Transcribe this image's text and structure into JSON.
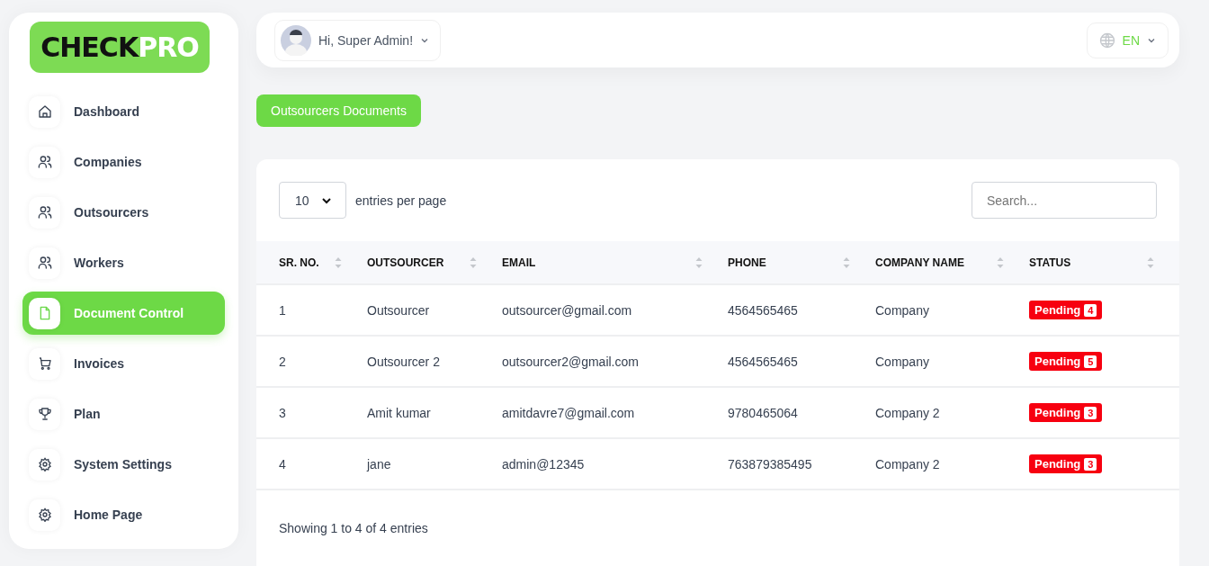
{
  "logo": {
    "dark": "CHECK",
    "light": "PRO"
  },
  "sidebar": {
    "items": [
      {
        "label": "Dashboard",
        "kind": "home",
        "selected": false
      },
      {
        "label": "Companies",
        "kind": "users",
        "selected": false
      },
      {
        "label": "Outsourcers",
        "kind": "users",
        "selected": false
      },
      {
        "label": "Workers",
        "kind": "users",
        "selected": false
      },
      {
        "label": "Document Control",
        "kind": "document",
        "selected": true
      },
      {
        "label": "Invoices",
        "kind": "cart",
        "selected": false
      },
      {
        "label": "Plan",
        "kind": "trophy",
        "selected": false
      },
      {
        "label": "System Settings",
        "kind": "gear",
        "selected": false
      },
      {
        "label": "Home Page",
        "kind": "gear",
        "selected": false
      }
    ]
  },
  "header": {
    "user": "Hi, Super Admin!",
    "language": "EN"
  },
  "page_button": "Outsourcers Documents",
  "table": {
    "page_size": "10",
    "page_size_label": "entries per page",
    "search": {
      "placeholder": "Search..."
    },
    "columns": [
      "SR. NO.",
      "OUTSOURCER",
      "EMAIL",
      "PHONE",
      "COMPANY NAME",
      "STATUS"
    ],
    "rows": [
      {
        "cells": [
          "1",
          "Outsourcer",
          "outsourcer@gmail.com",
          "4564565465",
          "Company"
        ],
        "status": "Pending",
        "count": "4"
      },
      {
        "cells": [
          "2",
          "Outsourcer 2",
          "outsourcer2@gmail.com",
          "4564565465",
          "Company"
        ],
        "status": "Pending",
        "count": "5"
      },
      {
        "cells": [
          "3",
          "Amit kumar",
          "amitdavre7@gmail.com",
          "9780465064",
          "Company 2"
        ],
        "status": "Pending",
        "count": "3"
      },
      {
        "cells": [
          "4",
          "jane",
          "admin@12345",
          "763879385495",
          "Company 2"
        ],
        "status": "Pending",
        "count": "3"
      }
    ],
    "footer": "Showing 1 to 4 of 4 entries"
  }
}
